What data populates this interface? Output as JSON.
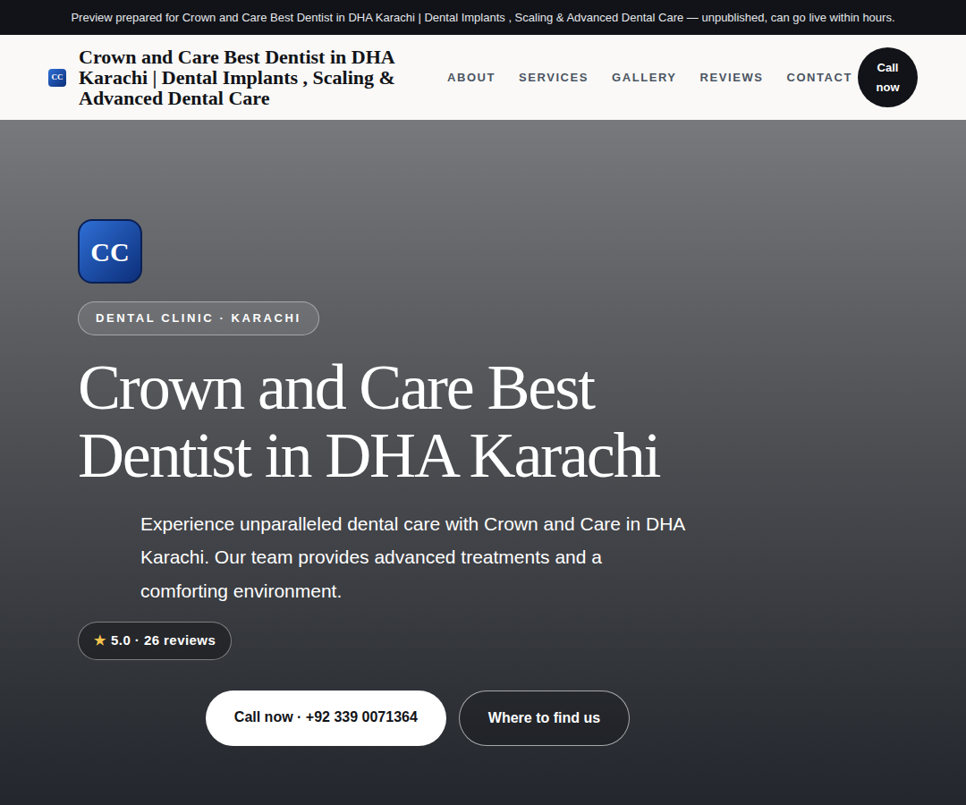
{
  "banner": "Preview prepared for Crown and Care Best Dentist in DHA Karachi | Dental Implants , Scaling & Advanced Dental Care — unpublished, can go live within hours.",
  "header": {
    "logo": "CC",
    "title": "Crown and Care Best Dentist in DHA Karachi | Dental Implants , Scaling & Advanced Dental Care",
    "nav": [
      "ABOUT",
      "SERVICES",
      "GALLERY",
      "REVIEWS",
      "CONTACT"
    ],
    "call": "Call now"
  },
  "hero": {
    "logo": "CC",
    "badge": "DENTAL CLINIC · KARACHI",
    "heading": "Crown and Care Best Dentist in DHA Karachi",
    "description": "Experience unparalleled dental care with Crown and Care in DHA Karachi. Our team provides advanced treatments and a comforting environment.",
    "rating": {
      "star": "★",
      "text": "5.0 · 26 reviews"
    },
    "buttons": [
      "Call now · +92 339 0071364",
      "Where to find us"
    ]
  }
}
